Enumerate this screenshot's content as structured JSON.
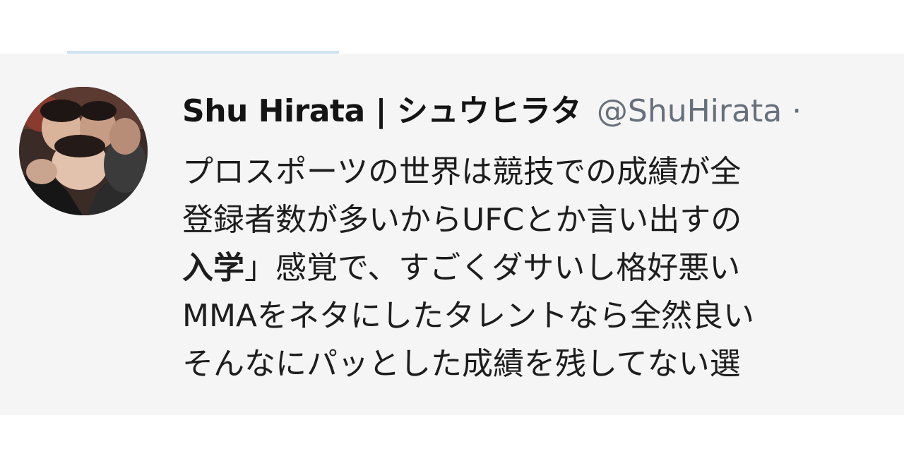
{
  "tweet": {
    "author": {
      "display_name": "Shu Hirata | シュウヒラタ",
      "handle": "@ShuHirata",
      "separator": "·",
      "avatar_icon": "profile-photo"
    },
    "lines": [
      {
        "text": "プロスポーツの世界は競技での成績が全"
      },
      {
        "text": "登録者数が多いからUFCとか言い出すの"
      },
      {
        "bold_text": "入学",
        "text": "」感覚で、すごくダサいし格好悪い"
      },
      {
        "text": "MMAをネタにしたタレントなら全然良い"
      },
      {
        "text": "そんなにパッとした成績を残してない選"
      }
    ]
  },
  "colors": {
    "card_background": "#f5f5f6",
    "divider": "#cfe3f2",
    "text_primary": "#1d1d1d",
    "text_secondary": "#67707a"
  }
}
